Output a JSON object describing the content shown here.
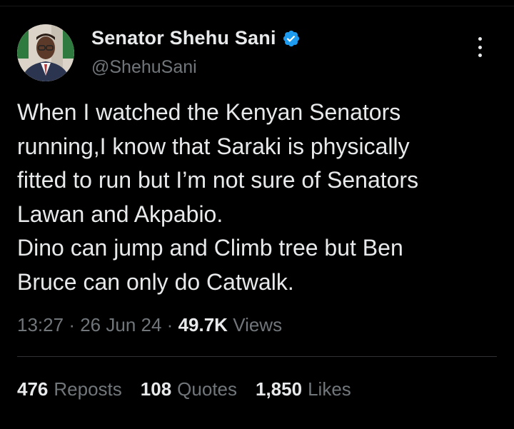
{
  "author": {
    "display_name": "Senator Shehu Sani",
    "handle": "@ShehuSani",
    "verified_icon": "verified-badge-icon",
    "verified_color": "#1d9bf0"
  },
  "tweet": {
    "text": "When I watched the Kenyan Senators\nrunning,I know that Saraki is physically\nfitted to run but I’m not sure of Senators\nLawan and Akpabio.\nDino can jump and Climb tree but Ben\nBruce can only do Catwalk."
  },
  "meta": {
    "time": "13:27",
    "sep1": "·",
    "date": "26 Jun 24",
    "sep2": "·",
    "views_count": "49.7K",
    "views_label": "Views"
  },
  "stats": {
    "reposts_count": "476",
    "reposts_label": "Reposts",
    "quotes_count": "108",
    "quotes_label": "Quotes",
    "likes_count": "1,850",
    "likes_label": "Likes"
  },
  "colors": {
    "background": "#000000",
    "text_primary": "#e7e9ea",
    "text_secondary": "#71767b",
    "divider": "#2f3336"
  }
}
